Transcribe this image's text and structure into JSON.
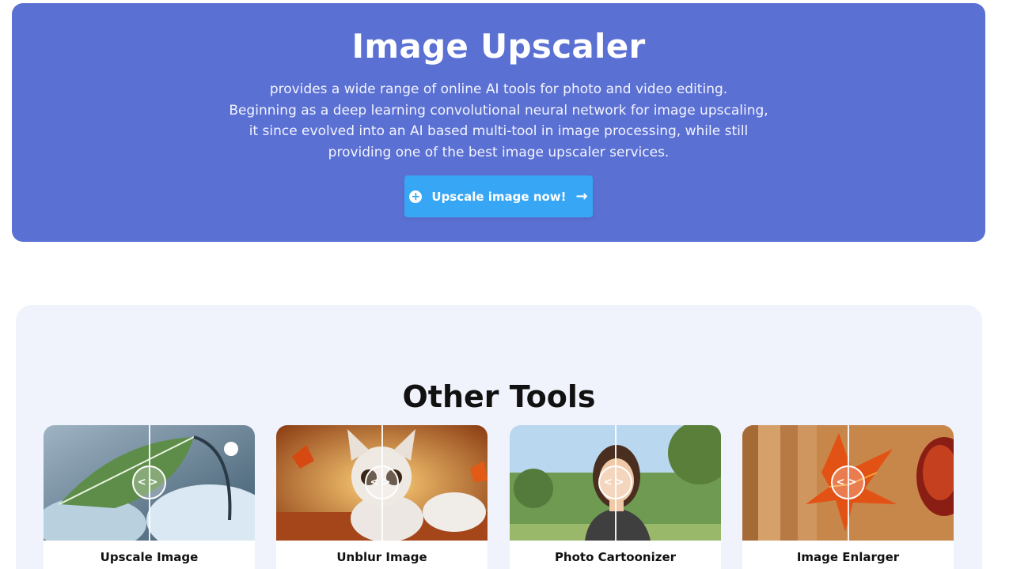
{
  "hero": {
    "title": "Image Upscaler",
    "description_lines": [
      "provides a wide range of online AI tools for photo and video editing.",
      "Beginning as a deep learning convolutional neural network for image upscaling,",
      "it since evolved into an AI based multi-tool in image processing, while still",
      "providing one of the best image upscaler services."
    ],
    "cta_label": "Upscale image now!",
    "cta_icon": "plus-circle-icon",
    "cta_arrow_icon": "arrow-right-icon"
  },
  "tools": {
    "heading": "Other Tools",
    "cards": [
      {
        "label": "Upscale Image",
        "handle_glyph": "<>"
      },
      {
        "label": "Unblur Image",
        "handle_glyph": "<>"
      },
      {
        "label": "Photo Cartoonizer",
        "handle_glyph": "<>"
      },
      {
        "label": "Image Enlarger",
        "handle_glyph": "<>"
      }
    ]
  },
  "colors": {
    "hero_bg": "#5b70d3",
    "cta_bg": "#36a6f5",
    "tools_bg": "#f0f3fc"
  }
}
